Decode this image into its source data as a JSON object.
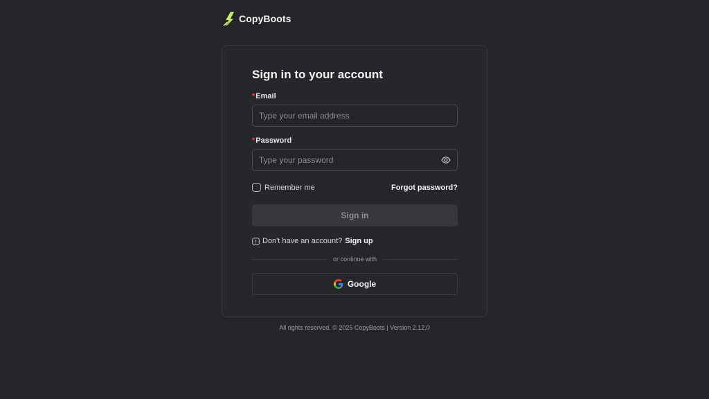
{
  "brand": {
    "name": "CopyBoots",
    "logo_icon": "boot-logo-icon"
  },
  "form": {
    "title": "Sign in to your account",
    "required_marker": "*",
    "email": {
      "label": "Email",
      "placeholder": "Type your email address",
      "value": ""
    },
    "password": {
      "label": "Password",
      "placeholder": "Type your password",
      "value": "",
      "toggle_icon": "eye-icon"
    },
    "remember_label": "Remember me",
    "remember_checked": false,
    "forgot_label": "Forgot password?",
    "signin_label": "Sign in",
    "signup_prompt": "Don't have an account?",
    "signup_label": "Sign up",
    "divider_text": "or continue with",
    "google_label": "Google"
  },
  "footer": {
    "text": "All rights reserved. © 2025 CopyBoots | Version 2.12.0"
  },
  "colors": {
    "background": "#242528",
    "card_border": "#3a3b3f",
    "required": "#e5484d",
    "disabled_button": "#37383c"
  }
}
